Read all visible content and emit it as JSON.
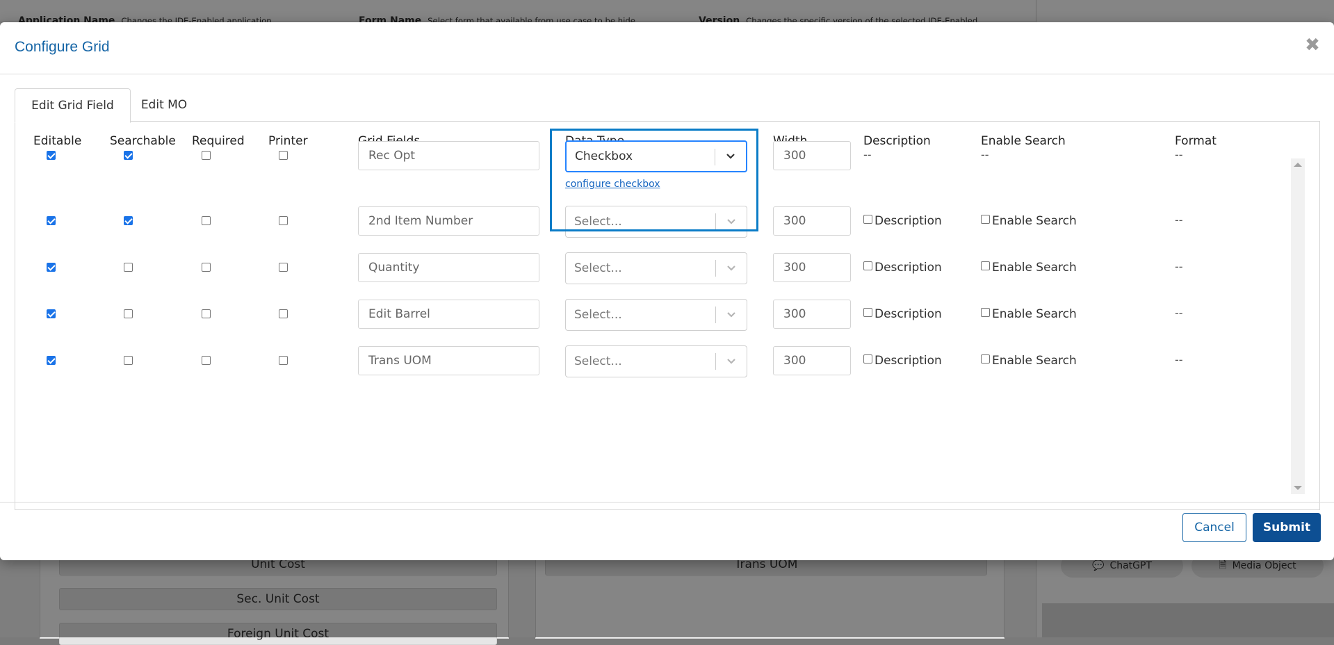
{
  "background": {
    "top_items": [
      {
        "label": "Application Name",
        "value": "Changes the JDE-Enabled application"
      },
      {
        "label": "Form Name",
        "value": "Select form that available from use case to be hide"
      },
      {
        "label": "Version",
        "value": "Changes the specific version of the selected JDE-Enabled"
      }
    ],
    "left_fields": [
      "Unit Cost",
      "Sec. Unit Cost",
      "Foreign Unit Cost"
    ],
    "middle_fields": [
      "Trans UOM"
    ],
    "right_buttons": [
      {
        "label": "ChatGPT",
        "icon": "chat-icon"
      },
      {
        "label": "Media Object",
        "icon": "document-icon"
      }
    ]
  },
  "modal": {
    "title": "Configure Grid",
    "tabs": [
      {
        "label": "Edit Grid Field",
        "active": true
      },
      {
        "label": "Edit MO",
        "active": false
      }
    ],
    "columns": {
      "editable": "Editable",
      "searchable": "Searchable",
      "required": "Required",
      "printer": "Printer",
      "grid_fields": "Grid Fields",
      "data_type": "Data Type",
      "width": "Width",
      "description": "Description",
      "enable_search": "Enable Search",
      "format": "Format"
    },
    "rows": [
      {
        "editable": true,
        "searchable": true,
        "required": false,
        "printer": false,
        "field": "Rec Opt",
        "data_type": "Checkbox",
        "data_type_link": "configure checkbox",
        "width": "300",
        "description": "--",
        "enable_search": "--",
        "format": "--"
      },
      {
        "editable": true,
        "searchable": true,
        "required": false,
        "printer": false,
        "field": "2nd Item Number",
        "data_type": "Select...",
        "width": "300",
        "description": "Description",
        "enable_search": "Enable Search",
        "format": "--"
      },
      {
        "editable": true,
        "searchable": false,
        "required": false,
        "printer": false,
        "field": "Quantity",
        "data_type": "Select...",
        "width": "300",
        "description": "Description",
        "enable_search": "Enable Search",
        "format": "--"
      },
      {
        "editable": true,
        "searchable": false,
        "required": false,
        "printer": false,
        "field": "Edit Barrel",
        "data_type": "Select...",
        "width": "300",
        "description": "Description",
        "enable_search": "Enable Search",
        "format": "--"
      },
      {
        "editable": true,
        "searchable": false,
        "required": false,
        "printer": false,
        "field": "Trans UOM",
        "data_type": "Select...",
        "width": "300",
        "description": "Description",
        "enable_search": "Enable Search",
        "format": "--"
      }
    ],
    "footer": {
      "cancel_label": "Cancel",
      "submit_label": "Submit"
    },
    "colors": {
      "accent": "#0d4f93",
      "title": "#1565a6",
      "highlight": "#0a7cc7",
      "checkbox": "#1a73e8"
    }
  }
}
